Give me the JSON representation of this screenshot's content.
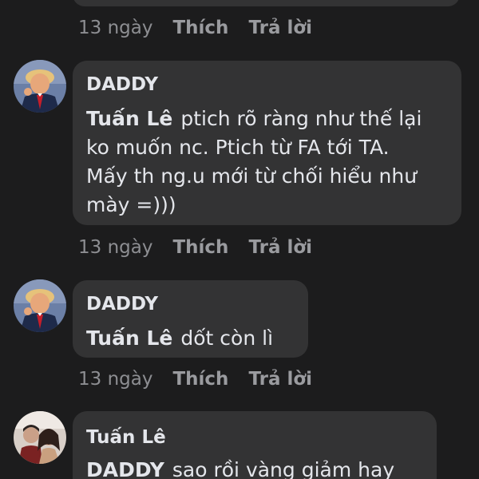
{
  "comments": [
    {
      "time": "13 ngày",
      "like_label": "Thích",
      "reply_label": "Trả lời"
    },
    {
      "author": "DADDY",
      "mention": "Tuấn Lê",
      "text_lines": [
        "ptich rõ ràng như thế lại",
        "ko muốn nc. Ptich từ FA tới TA.",
        "Mấy th ng.u mới từ chối hiểu như",
        "mày =)))"
      ],
      "time": "13 ngày",
      "like_label": "Thích",
      "reply_label": "Trả lời"
    },
    {
      "author": "DADDY",
      "mention": "Tuấn Lê",
      "text": "dốt còn lì",
      "time": "13 ngày",
      "like_label": "Thích",
      "reply_label": "Trả lời"
    },
    {
      "author": "Tuấn Lê",
      "mention": "DADDY",
      "text": "sao rồi vàng giảm hay"
    }
  ],
  "colors": {
    "background": "#1c1c1d",
    "bubble": "#333334",
    "text": "#e4e6eb",
    "meta": "#8d8e92"
  }
}
